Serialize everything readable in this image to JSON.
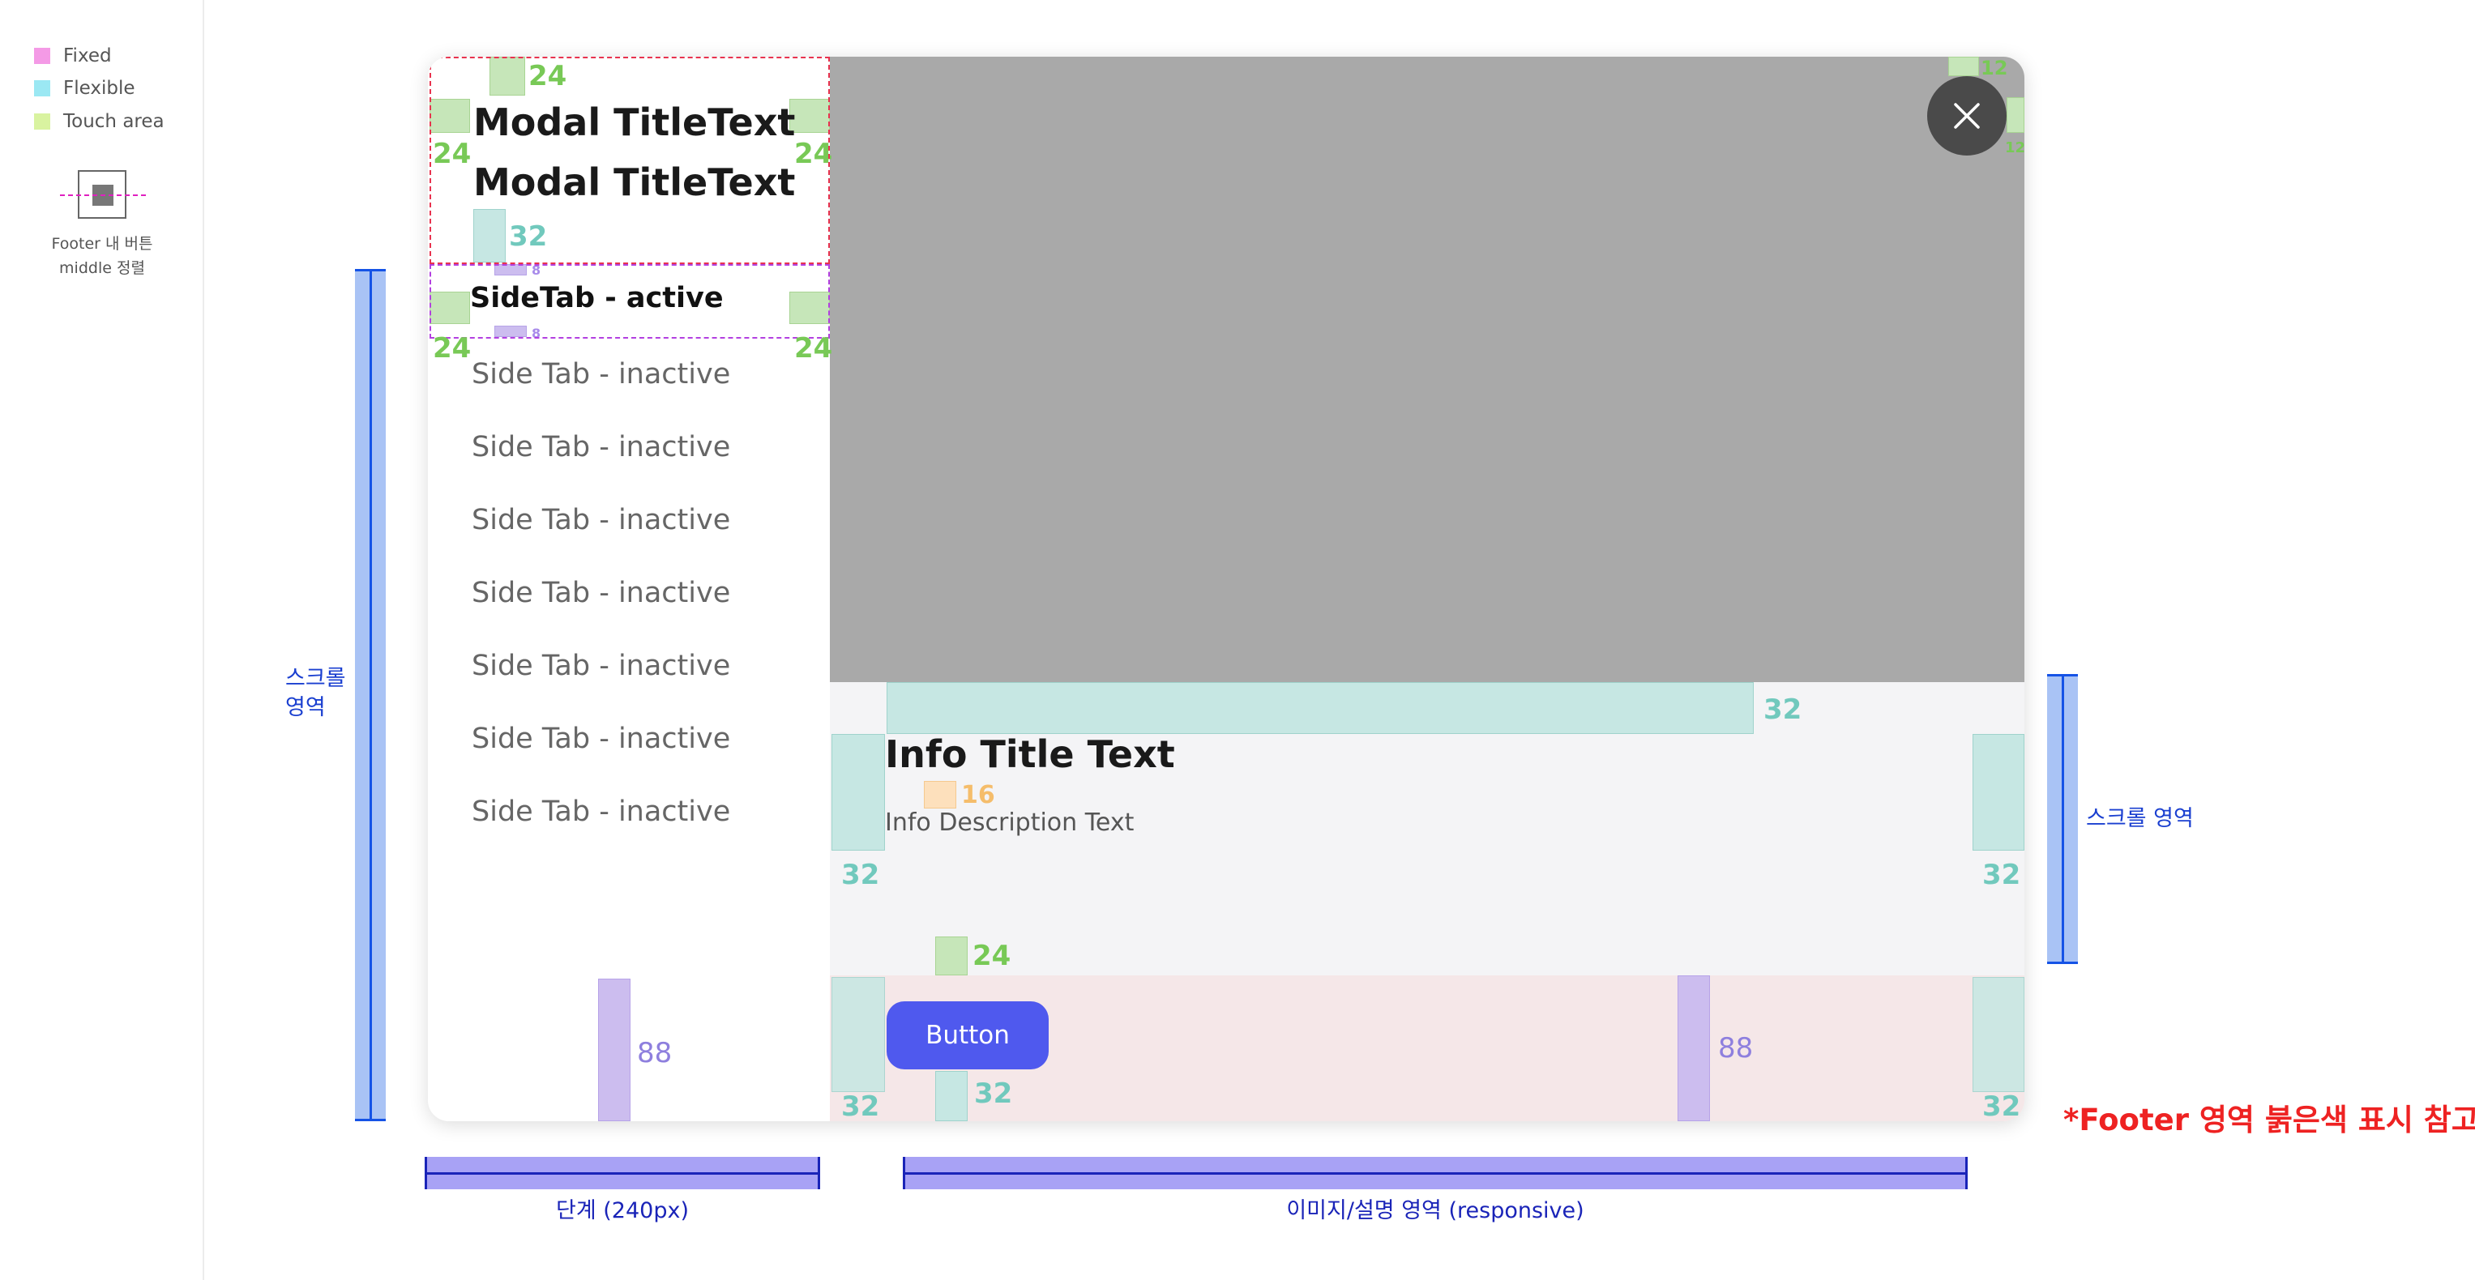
{
  "legend": {
    "items": [
      {
        "label": "Fixed",
        "color": "#f49ae6"
      },
      {
        "label": "Flexible",
        "color": "#9be8f3"
      },
      {
        "label": "Touch area",
        "color": "#d9f3a0"
      }
    ],
    "footer_caption_line1": "Footer 내 버튼",
    "footer_caption_line2": "middle 정렬"
  },
  "modal": {
    "title_line1": "Modal TitleText",
    "title_line2": "Modal TitleText",
    "active_tab": "SideTab - active",
    "tabs": [
      "Side Tab - inactive",
      "Side Tab - inactive",
      "Side Tab - inactive",
      "Side Tab - inactive",
      "Side Tab - inactive",
      "Side Tab - inactive",
      "Side Tab - inactive"
    ],
    "info_title": "Info Title Text",
    "info_description": "Info Description Text",
    "button_label": "Button",
    "close_icon": "close-icon"
  },
  "spacing": {
    "s24": "24",
    "s32": "32",
    "s16": "16",
    "s8": "8",
    "s88": "88",
    "s12": "12"
  },
  "annotations": {
    "scroll_left_line1": "스크롤",
    "scroll_left_line2": "영역",
    "scroll_right": "스크롤 영역",
    "step_width": "단계 (240px)",
    "image_area": "이미지/설명 영역 (responsive)",
    "footer_note": "*Footer 영역 붉은색 표시 참고"
  },
  "colors": {
    "primary_button": "#4f59ee",
    "image_placeholder": "#a9a9a9",
    "footer_highlight": "#f5e7e8",
    "info_background": "#f4f4f6"
  }
}
